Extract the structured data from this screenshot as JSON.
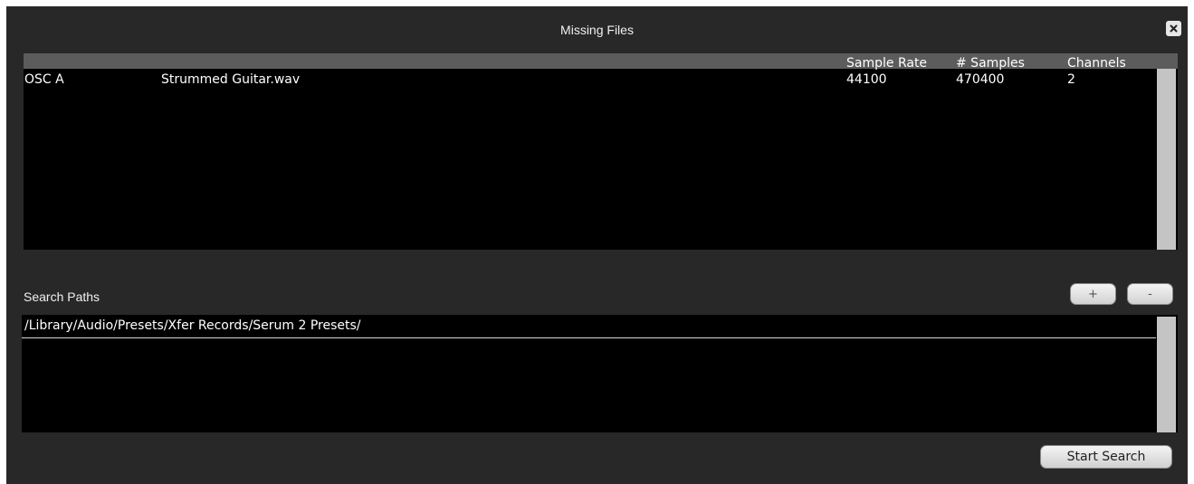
{
  "window": {
    "title": "Missing Files"
  },
  "files_table": {
    "columns": [
      {
        "label": ""
      },
      {
        "label": ""
      },
      {
        "label": "Sample Rate"
      },
      {
        "label": "# Samples"
      },
      {
        "label": "Channels"
      }
    ],
    "rows": [
      {
        "source": "OSC A",
        "filename": "Strummed Guitar.wav",
        "sample_rate": "44100",
        "num_samples": "470400",
        "channels": "2"
      }
    ]
  },
  "search_paths": {
    "label": "Search Paths",
    "add_label": "+",
    "remove_label": "-",
    "paths": [
      "/Library/Audio/Presets/Xfer Records/Serum 2 Presets/"
    ]
  },
  "actions": {
    "start_search_label": "Start Search"
  },
  "icons": {
    "close": "close-icon"
  },
  "colors": {
    "window_bg": "#282828",
    "panel_bg": "#000000",
    "header_bar": "#5c5c5c",
    "scrollbar": "#c4c4c4",
    "text": "#ffffff"
  }
}
